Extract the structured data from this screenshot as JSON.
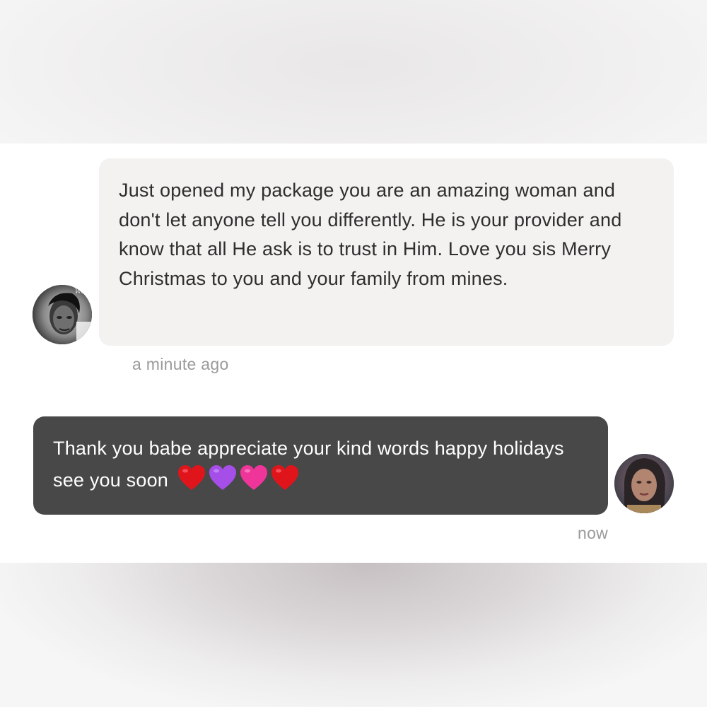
{
  "conversation": {
    "messages": [
      {
        "sender": "other",
        "text": "Just opened my package you are an amazing woman and don't let anyone tell you differently. He is your provider and know that all He ask is to trust in Him. Love you sis Merry Christmas to you and your family from mines.",
        "timestamp": "a minute ago",
        "avatar_badge_text": "Worth it"
      },
      {
        "sender": "me",
        "text": "Thank you babe appreciate your kind words happy holidays see you soon",
        "emojis": [
          "red-heart",
          "purple-heart",
          "pink-heart",
          "red-heart"
        ],
        "timestamp": "now"
      }
    ]
  },
  "colors": {
    "incoming_bubble": "#f4f2f0",
    "outgoing_bubble": "#484848",
    "timestamp": "#9a9a9a",
    "heart_red": "#e0151c",
    "heart_purple": "#a64ee8",
    "heart_pink": "#f0359a"
  }
}
